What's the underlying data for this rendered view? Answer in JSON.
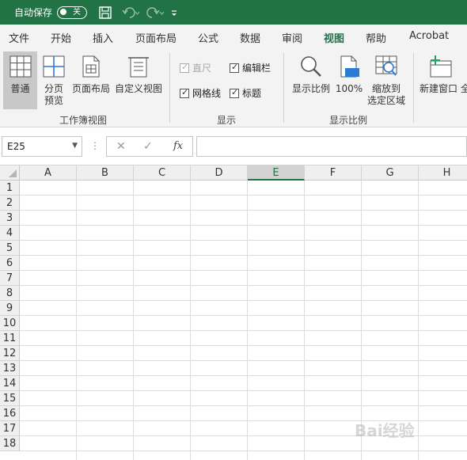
{
  "titlebar": {
    "autosave_label": "自动保存",
    "autosave_state": "关"
  },
  "tabs": [
    {
      "label": "文件"
    },
    {
      "label": "开始"
    },
    {
      "label": "插入"
    },
    {
      "label": "页面布局"
    },
    {
      "label": "公式"
    },
    {
      "label": "数据"
    },
    {
      "label": "审阅"
    },
    {
      "label": "视图",
      "active": true
    },
    {
      "label": "帮助"
    },
    {
      "label": "Acrobat"
    }
  ],
  "ribbon": {
    "workbook_views": {
      "normal": "普通",
      "page_break_line1": "分页",
      "page_break_line2": "预览",
      "page_layout": "页面布局",
      "custom_views": "自定义视图",
      "group_label": "工作簿视图"
    },
    "show": {
      "ruler": "直尺",
      "formula_bar": "编辑栏",
      "gridlines": "网格线",
      "headings": "标题",
      "group_label": "显示"
    },
    "zoom": {
      "zoom": "显示比例",
      "zoom_100": "100%",
      "zoom_to_sel_line1": "缩放到",
      "zoom_to_sel_line2": "选定区域",
      "group_label": "显示比例",
      "icon_badge": "100"
    },
    "window": {
      "new_window": "新建窗口",
      "truncated": "全"
    }
  },
  "formula_bar": {
    "name_box": "E25",
    "formula": "",
    "fx": "fx"
  },
  "grid": {
    "columns": [
      "A",
      "B",
      "C",
      "D",
      "E",
      "F",
      "G",
      "H"
    ],
    "active_column": "E",
    "rows": [
      "1",
      "2",
      "3",
      "4",
      "5",
      "6",
      "7",
      "8",
      "9",
      "10",
      "11",
      "12",
      "13",
      "14",
      "15",
      "16",
      "17",
      "18"
    ]
  },
  "watermark": "Bai经验",
  "colors": {
    "brand": "#217346",
    "ribbon_bg": "#f3f3f3"
  }
}
